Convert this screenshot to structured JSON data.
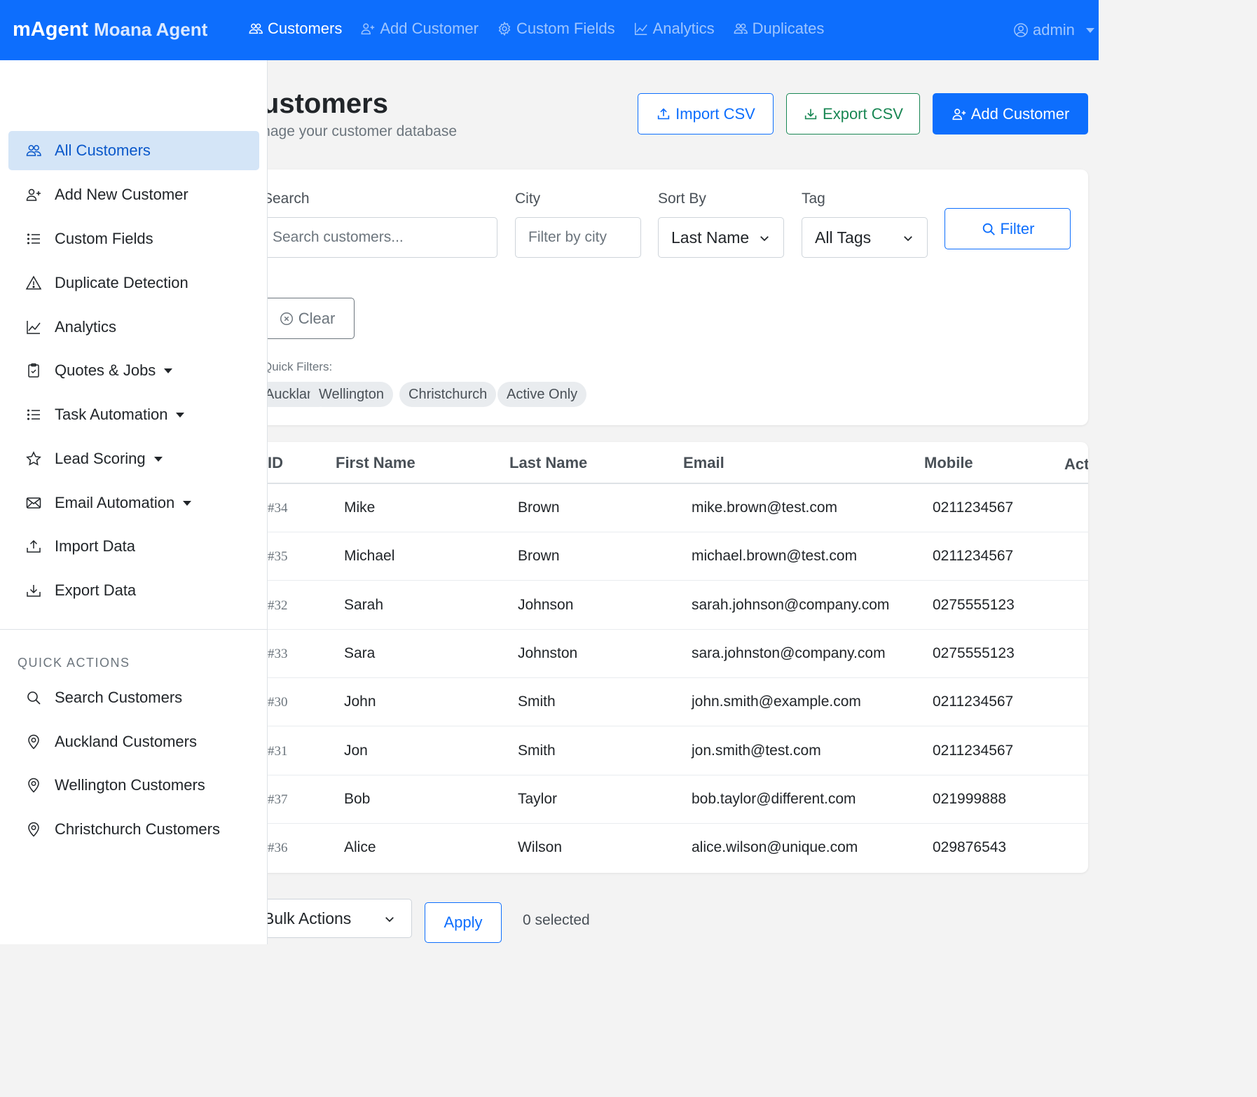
{
  "navbar": {
    "brand": "mAgent",
    "brand_sub": "Moana Agent",
    "links": [
      {
        "label": "Customers",
        "icon": "people-icon",
        "active": true
      },
      {
        "label": "Add Customer",
        "icon": "person-plus-icon",
        "active": false
      },
      {
        "label": "Custom Fields",
        "icon": "gear-icon",
        "active": false
      },
      {
        "label": "Analytics",
        "icon": "graph-icon",
        "active": false
      },
      {
        "label": "Duplicates",
        "icon": "people-icon",
        "active": false
      }
    ],
    "user": "admin"
  },
  "page": {
    "title": "Customers",
    "subtitle": "Manage your customer database",
    "import_label": "Import CSV",
    "export_label": "Export CSV",
    "add_label": "Add Customer"
  },
  "filters": {
    "search_label": "Search",
    "search_placeholder": "Search customers...",
    "city_label": "City",
    "city_placeholder": "Filter by city",
    "sort_label": "Sort By",
    "sort_value": "Last Name",
    "tag_label": "Tag",
    "tag_value": "All Tags",
    "filter_label": "Filter",
    "clear_label": "Clear",
    "quick_label": "Quick Filters:",
    "quick": [
      "Auckland",
      "Wellington",
      "Christchurch",
      "Active Only"
    ]
  },
  "table": {
    "headers": [
      "ID",
      "First Name",
      "Last Name",
      "Email",
      "Mobile",
      "Actions"
    ],
    "rows": [
      {
        "id": "#34",
        "first": "Mike",
        "last": "Brown",
        "email": "mike.brown@test.com",
        "mobile": "0211234567"
      },
      {
        "id": "#35",
        "first": "Michael",
        "last": "Brown",
        "email": "michael.brown@test.com",
        "mobile": "0211234567"
      },
      {
        "id": "#32",
        "first": "Sarah",
        "last": "Johnson",
        "email": "sarah.johnson@company.com",
        "mobile": "0275555123"
      },
      {
        "id": "#33",
        "first": "Sara",
        "last": "Johnston",
        "email": "sara.johnston@company.com",
        "mobile": "0275555123"
      },
      {
        "id": "#30",
        "first": "John",
        "last": "Smith",
        "email": "john.smith@example.com",
        "mobile": "0211234567"
      },
      {
        "id": "#31",
        "first": "Jon",
        "last": "Smith",
        "email": "jon.smith@test.com",
        "mobile": "0211234567"
      },
      {
        "id": "#37",
        "first": "Bob",
        "last": "Taylor",
        "email": "bob.taylor@different.com",
        "mobile": "021999888"
      },
      {
        "id": "#36",
        "first": "Alice",
        "last": "Wilson",
        "email": "alice.wilson@unique.com",
        "mobile": "029876543"
      }
    ]
  },
  "bulk": {
    "select_value": "Bulk Actions",
    "apply_label": "Apply",
    "selected_text": "0 selected"
  },
  "sidebar": {
    "items": [
      {
        "label": "All Customers",
        "icon": "people-icon",
        "active": true,
        "caret": false
      },
      {
        "label": "Add New Customer",
        "icon": "person-plus-icon",
        "active": false,
        "caret": false
      },
      {
        "label": "Custom Fields",
        "icon": "list-icon",
        "active": false,
        "caret": false
      },
      {
        "label": "Duplicate Detection",
        "icon": "warning-icon",
        "active": false,
        "caret": false
      },
      {
        "label": "Analytics",
        "icon": "graph-icon",
        "active": false,
        "caret": false
      },
      {
        "label": "Quotes & Jobs",
        "icon": "clipboard-icon",
        "active": false,
        "caret": true
      },
      {
        "label": "Task Automation",
        "icon": "list-icon",
        "active": false,
        "caret": true
      },
      {
        "label": "Lead Scoring",
        "icon": "star-icon",
        "active": false,
        "caret": true
      },
      {
        "label": "Email Automation",
        "icon": "envelope-icon",
        "active": false,
        "caret": true
      },
      {
        "label": "Import Data",
        "icon": "upload-icon",
        "active": false,
        "caret": false
      },
      {
        "label": "Export Data",
        "icon": "download-icon",
        "active": false,
        "caret": false
      }
    ],
    "quick_heading": "QUICK ACTIONS",
    "quick_items": [
      {
        "label": "Search Customers",
        "icon": "search-icon"
      },
      {
        "label": "Auckland Customers",
        "icon": "geo-pin-icon"
      },
      {
        "label": "Wellington Customers",
        "icon": "geo-pin-icon"
      },
      {
        "label": "Christchurch Customers",
        "icon": "geo-pin-icon"
      }
    ]
  },
  "colors": {
    "primary": "#0d6efd",
    "success": "#198754",
    "active_bg": "#d4e5f7",
    "page_bg": "#f3f3f3"
  }
}
